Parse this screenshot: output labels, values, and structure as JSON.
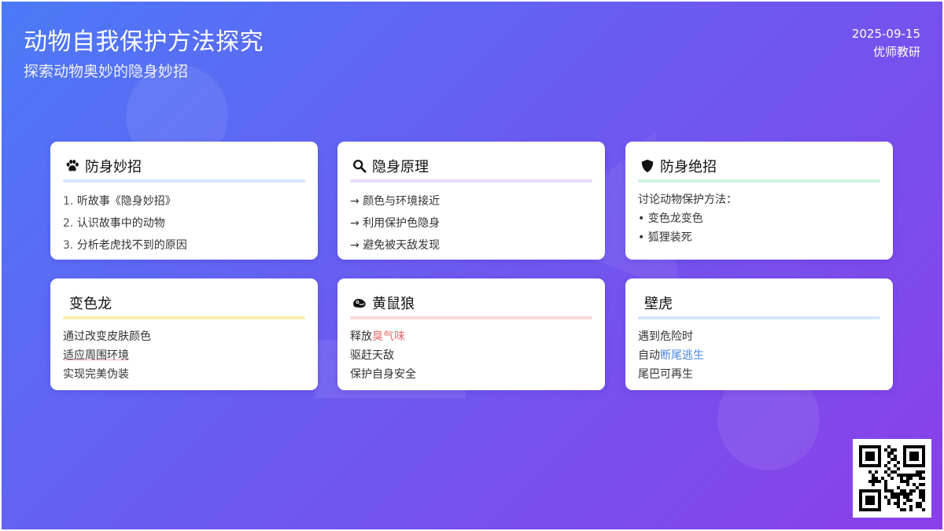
{
  "header": {
    "title": "动物自我保护方法探究",
    "subtitle": "探索动物奥妙的隐身妙招",
    "date": "2025-09-15",
    "author": "优师教研"
  },
  "cards": [
    {
      "title": "防身妙招",
      "icon": "paw-icon",
      "rule_color": "#d6e6fb",
      "items": [
        {
          "num": "1.",
          "text": "听故事《隐身妙招》"
        },
        {
          "num": "2.",
          "text": "认识故事中的动物"
        },
        {
          "num": "3.",
          "text": "分析老虎找不到的原因"
        }
      ]
    },
    {
      "title": "隐身原理",
      "icon": "search-icon",
      "rule_color": "#e9dcf8",
      "items": [
        {
          "num": "→",
          "text": "颜色与环境接近"
        },
        {
          "num": "→",
          "text": "利用保护色隐身"
        },
        {
          "num": "→",
          "text": "避免被天敌发现"
        }
      ]
    },
    {
      "title": "防身绝招",
      "icon": "shield-icon",
      "rule_color": "#cdf3dd",
      "intro": "讨论动物保护方法：",
      "items": [
        {
          "num": "•",
          "text": "变色龙变色"
        },
        {
          "num": "•",
          "text": "狐狸装死"
        }
      ]
    },
    {
      "title": "变色龙",
      "rule_color": "#fbefb0",
      "lines": [
        "通过改变皮肤颜色",
        "适应周围环境",
        "实现完美伪装"
      ]
    },
    {
      "title": "黄鼠狼",
      "icon": "weasel-icon",
      "rule_color": "#fbd9da",
      "lines": [
        {
          "prefix": "释放",
          "highlight": "臭气味"
        },
        {
          "prefix": "驱赶天敌"
        },
        {
          "prefix": "保护自身安全"
        }
      ]
    },
    {
      "title": "壁虎",
      "rule_color": "#d6e6fb",
      "lines": [
        {
          "prefix": "遇到危险时"
        },
        {
          "prefix": "自动",
          "highlight": "断尾逃生"
        },
        {
          "prefix": "尾巴可再生"
        }
      ]
    }
  ],
  "qr": {
    "icon": "qr-code-icon"
  }
}
